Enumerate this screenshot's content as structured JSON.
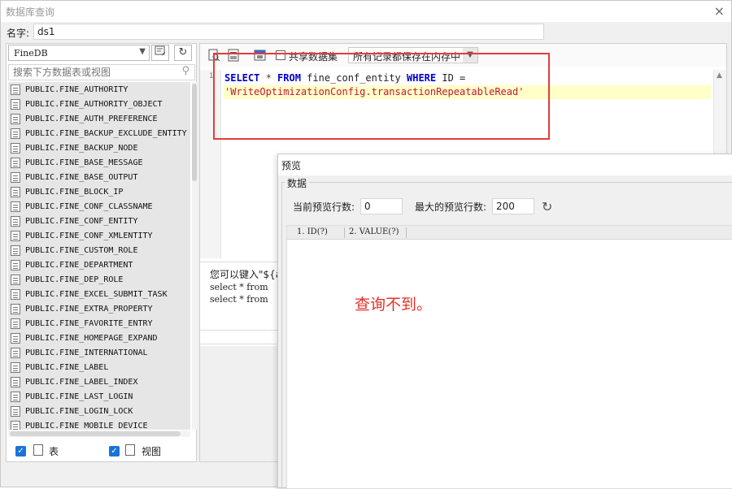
{
  "window": {
    "title": "数据库查询",
    "close_glyph": "×"
  },
  "name_row": {
    "label": "名字:",
    "value": "ds1"
  },
  "left_panel": {
    "database": "FineDB",
    "search_placeholder": "搜索下方数据表或视图",
    "tables": [
      "PUBLIC.FINE_AUTHORITY",
      "PUBLIC.FINE_AUTHORITY_OBJECT",
      "PUBLIC.FINE_AUTH_PREFERENCE",
      "PUBLIC.FINE_BACKUP_EXCLUDE_ENTITY",
      "PUBLIC.FINE_BACKUP_NODE",
      "PUBLIC.FINE_BASE_MESSAGE",
      "PUBLIC.FINE_BASE_OUTPUT",
      "PUBLIC.FINE_BLOCK_IP",
      "PUBLIC.FINE_CONF_CLASSNAME",
      "PUBLIC.FINE_CONF_ENTITY",
      "PUBLIC.FINE_CONF_XMLENTITY",
      "PUBLIC.FINE_CUSTOM_ROLE",
      "PUBLIC.FINE_DEPARTMENT",
      "PUBLIC.FINE_DEP_ROLE",
      "PUBLIC.FINE_EXCEL_SUBMIT_TASK",
      "PUBLIC.FINE_EXTRA_PROPERTY",
      "PUBLIC.FINE_FAVORITE_ENTRY",
      "PUBLIC.FINE_HOMEPAGE_EXPAND",
      "PUBLIC.FINE_INTERNATIONAL",
      "PUBLIC.FINE_LABEL",
      "PUBLIC.FINE_LABEL_INDEX",
      "PUBLIC.FINE_LAST_LOGIN",
      "PUBLIC.FINE_LOGIN_LOCK",
      "PUBLIC.FINE_MOBILE_DEVICE"
    ],
    "footer": {
      "table_label": "表",
      "view_label": "视图"
    }
  },
  "toolbar": {
    "share_label": "共享数据集",
    "cache_option": "所有记录都保存在内存中"
  },
  "editor": {
    "line_number": "1",
    "code_line1": {
      "kw1": "SELECT",
      "star": " * ",
      "kw2": "FROM",
      "table": " fine_conf_entity ",
      "kw3": "WHERE",
      "rest": " ID ="
    },
    "code_line2": "'WriteOptimizationConfig.transactionRepeatableRead'"
  },
  "hint": {
    "line1": "您可以键入\"${a",
    "line2": "select * from",
    "line3": "select * from"
  },
  "preview": {
    "title": "预览",
    "group_label": "数据",
    "current_rows_label": "当前预览行数:",
    "current_rows_value": "0",
    "max_rows_label": "最大的预览行数:",
    "max_rows_value": "200",
    "columns": [
      "1.  ID(?)",
      "2.  VALUE(?)"
    ],
    "annotation": "查询不到。"
  },
  "colors": {
    "annotation_red": "#e4312b",
    "keyword_blue": "#0000d0",
    "string_red": "#c4163b",
    "checkbox_blue": "#1a73d9"
  }
}
